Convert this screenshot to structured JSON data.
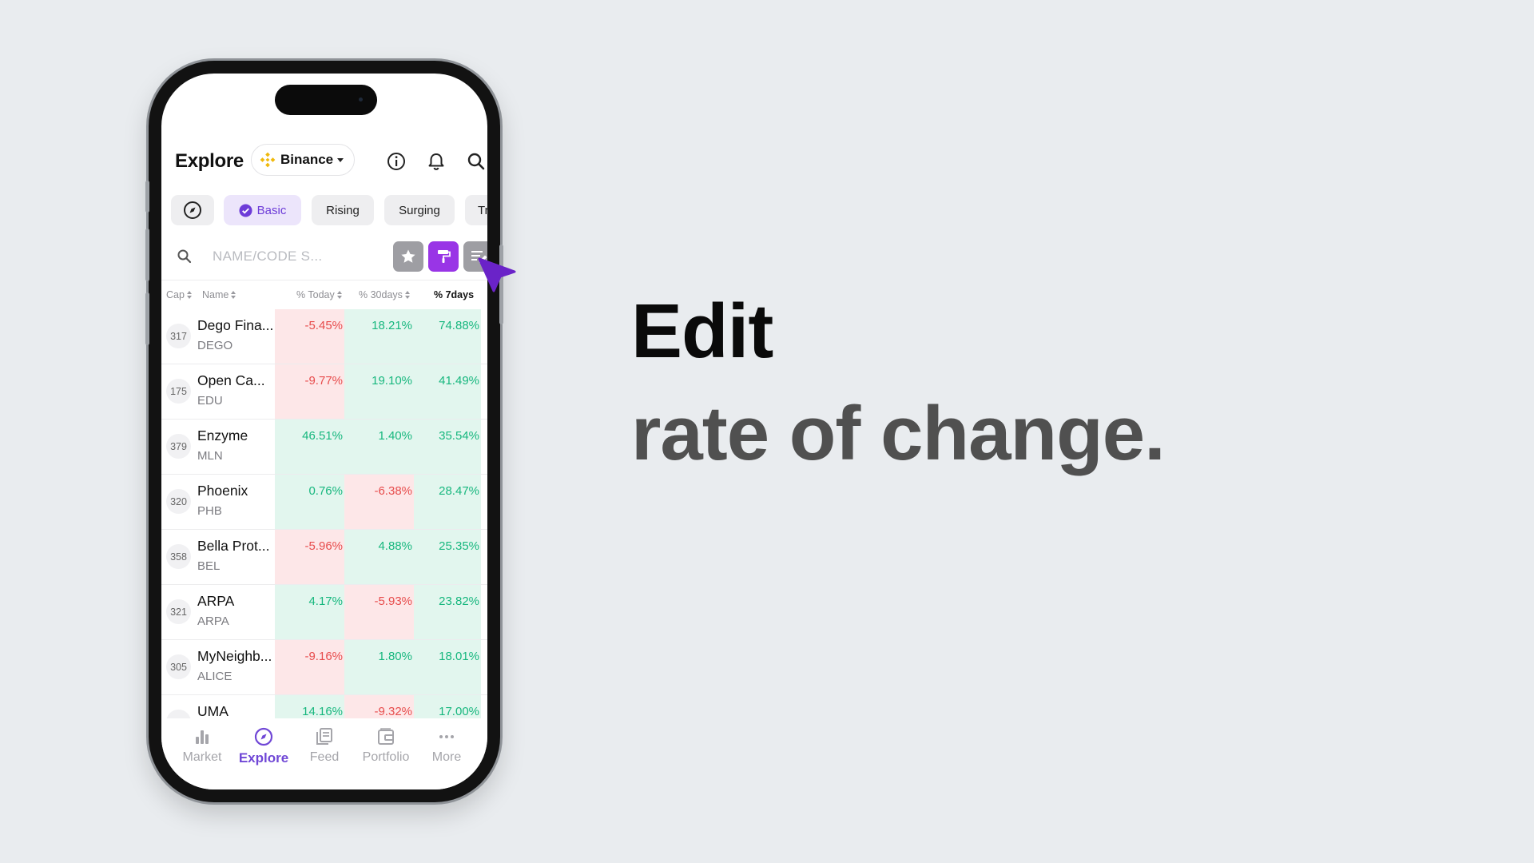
{
  "header": {
    "title": "Explore",
    "exchange": "Binance"
  },
  "chips": [
    "Basic",
    "Rising",
    "Surging",
    "Tre"
  ],
  "search": {
    "placeholder": "NAME/CODE S..."
  },
  "columns": [
    "Cap",
    "Name",
    "% Today",
    "% 30days",
    "% 7days"
  ],
  "rows": [
    {
      "rank": "317",
      "name": "Dego Fina...",
      "code": "DEGO",
      "today": "-5.45%",
      "d30": "18.21%",
      "d7": "74.88%"
    },
    {
      "rank": "175",
      "name": "Open Ca...",
      "code": "EDU",
      "today": "-9.77%",
      "d30": "19.10%",
      "d7": "41.49%"
    },
    {
      "rank": "379",
      "name": "Enzyme",
      "code": "MLN",
      "today": "46.51%",
      "d30": "1.40%",
      "d7": "35.54%"
    },
    {
      "rank": "320",
      "name": "Phoenix",
      "code": "PHB",
      "today": "0.76%",
      "d30": "-6.38%",
      "d7": "28.47%"
    },
    {
      "rank": "358",
      "name": "Bella Prot...",
      "code": "BEL",
      "today": "-5.96%",
      "d30": "4.88%",
      "d7": "25.35%"
    },
    {
      "rank": "321",
      "name": "ARPA",
      "code": "ARPA",
      "today": "4.17%",
      "d30": "-5.93%",
      "d7": "23.82%"
    },
    {
      "rank": "305",
      "name": "MyNeighb...",
      "code": "ALICE",
      "today": "-9.16%",
      "d30": "1.80%",
      "d7": "18.01%"
    },
    {
      "rank": "",
      "name": "UMA",
      "code": "",
      "today": "14.16%",
      "d30": "-9.32%",
      "d7": "17.00%"
    }
  ],
  "nav": [
    "Market",
    "Explore",
    "Feed",
    "Portfolio",
    "More"
  ],
  "headline": "Edit",
  "subline": "rate of change.",
  "colors": {
    "accent": "#7047d6",
    "positive": "#17b77e",
    "negative": "#e74c4c",
    "paint_button": "#9935e6"
  }
}
